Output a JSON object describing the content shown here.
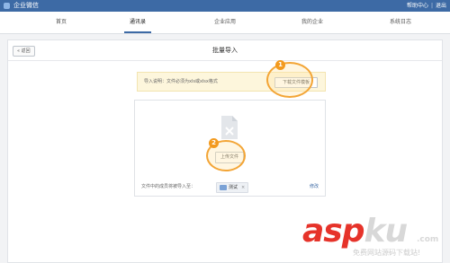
{
  "topbar": {
    "app_title": "企业微信",
    "links": [
      "帮助中心",
      "|",
      "退出"
    ]
  },
  "nav": {
    "tabs": [
      "首页",
      "通讯录",
      "企业应用",
      "我的企业",
      "系统日志"
    ],
    "active_index": 1
  },
  "page": {
    "back_label": "« 返回",
    "title": "批量导入"
  },
  "notice": {
    "text": "导入说明：文件必须为xls或xlsx格式",
    "download_label": "下载文件模板"
  },
  "upload": {
    "button_label": "上传文件",
    "target_label": "文件中的成员将被导入至：",
    "dept_name": "测试",
    "dept_remove": "×",
    "modify_label": "修改"
  },
  "callouts": [
    "1",
    "2"
  ],
  "watermark": {
    "brand_main": "asp",
    "brand_ku": "ku",
    "dotcom": ".com",
    "sub": "免费网站源码下载站!"
  },
  "colors": {
    "topbar": "#3d6aa5",
    "accent": "#3d6aa5",
    "notice_bg": "#fdf6dc",
    "callout": "#f39a1e"
  }
}
